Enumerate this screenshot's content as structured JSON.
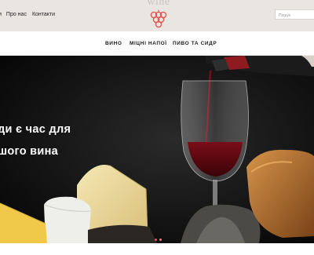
{
  "topnav": {
    "links": [
      "и",
      "Про нас",
      "Контакти"
    ]
  },
  "logo": {
    "word": "wine"
  },
  "search": {
    "placeholder": "Пошук"
  },
  "mainnav": {
    "items": [
      "ВИНО",
      "МІЦНІ НАПОЇ",
      "ПИВО ТА СИДР"
    ]
  },
  "hero": {
    "line1": "ди є час для",
    "line2": "шого вина"
  },
  "carousel": {
    "slide_count": 2,
    "active_index": 1
  },
  "colors": {
    "accent": "#e3534f",
    "background": "#e9e6e1"
  },
  "icons": {
    "logo_mark": "grapes-icon"
  }
}
